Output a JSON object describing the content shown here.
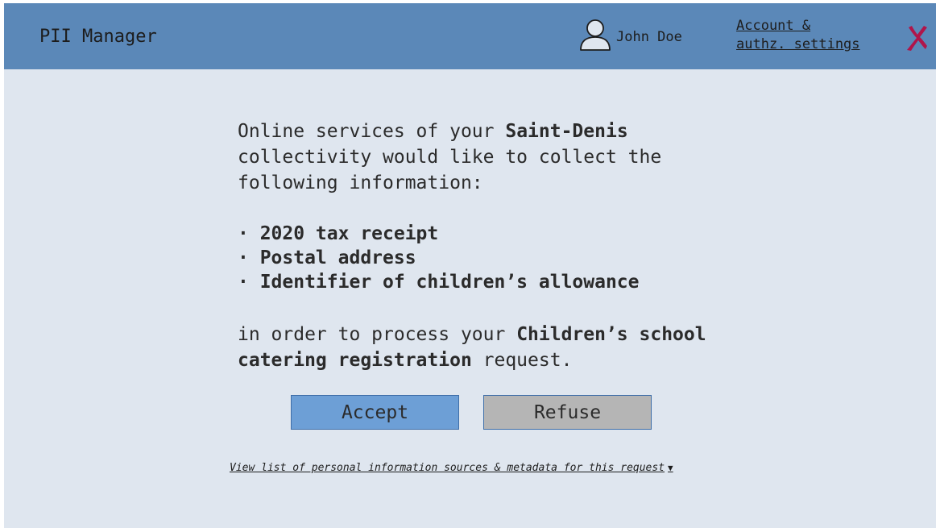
{
  "header": {
    "app_title": "PII Manager",
    "user_name": "John Doe",
    "account_link_line1": "Account &",
    "account_link_line2": "authz. settings",
    "close_color": "#b0154a"
  },
  "consent": {
    "intro_prefix": "Online services of your ",
    "intro_org": "Saint-Denis",
    "intro_suffix": " collectivity would like to collect the following information:",
    "items": [
      "· 2020 tax receipt",
      "· Postal address",
      "· Identifier of children’s allowance"
    ],
    "purpose_prefix": "in order to process your ",
    "purpose_request": "Children’s school catering registration",
    "purpose_suffix": " request."
  },
  "actions": {
    "accept_label": "Accept",
    "refuse_label": "Refuse"
  },
  "details": {
    "link_label": "View list of personal information sources & metadata for this request",
    "caret": "▼"
  },
  "colors": {
    "header_bg": "#5b88b8",
    "page_bg": "#dfe6ef",
    "accept_bg": "#6d9fd6",
    "refuse_bg": "#b5b5b5"
  }
}
